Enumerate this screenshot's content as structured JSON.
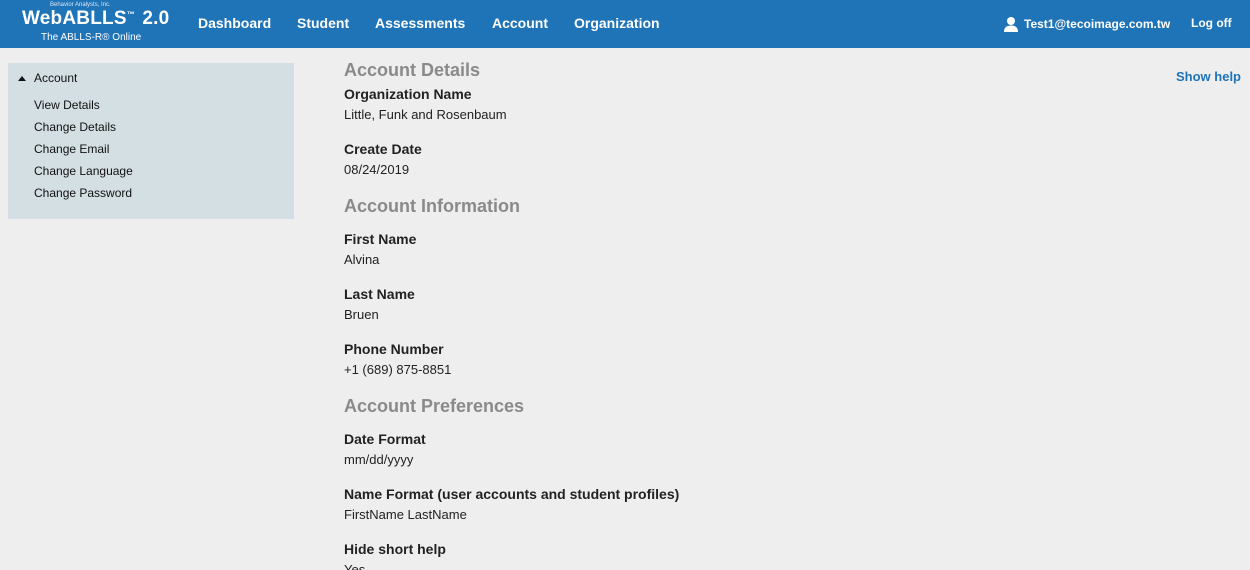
{
  "header": {
    "logo": {
      "company": "Behavior Analysts, Inc.",
      "product": "WebABLLS",
      "trademark": "™",
      "version": "2.0",
      "tagline": "The ABLLS-R® Online"
    },
    "nav": [
      "Dashboard",
      "Student",
      "Assessments",
      "Account",
      "Organization"
    ],
    "user_email": "Test1@tecoimage.com.tw",
    "logoff_label": "Log off"
  },
  "sidebar": {
    "section_label": "Account",
    "items": [
      "View Details",
      "Change Details",
      "Change Email",
      "Change Language",
      "Change Password"
    ]
  },
  "help_label": "Show help",
  "content": {
    "details_title": "Account Details",
    "org_name_label": "Organization Name",
    "org_name_value": "Little, Funk and Rosenbaum",
    "create_date_label": "Create Date",
    "create_date_value": "08/24/2019",
    "info_title": "Account Information",
    "first_name_label": "First Name",
    "first_name_value": "Alvina",
    "last_name_label": "Last Name",
    "last_name_value": "Bruen",
    "phone_label": "Phone Number",
    "phone_value": "+1 (689) 875-8851",
    "prefs_title": "Account Preferences",
    "date_format_label": "Date Format",
    "date_format_value": "mm/dd/yyyy",
    "name_format_label": "Name Format (user accounts and student profiles)",
    "name_format_value": "FirstName LastName",
    "short_help_label": "Hide short help",
    "short_help_value": "Yes"
  },
  "colors": {
    "topbar": "#1f73b7",
    "sidebar": "#d4dfe4",
    "background": "#eeeeee",
    "section_title": "#8a8a8a",
    "link": "#1f73b7"
  },
  "icons": [
    "user-icon",
    "caret-up-icon"
  ]
}
